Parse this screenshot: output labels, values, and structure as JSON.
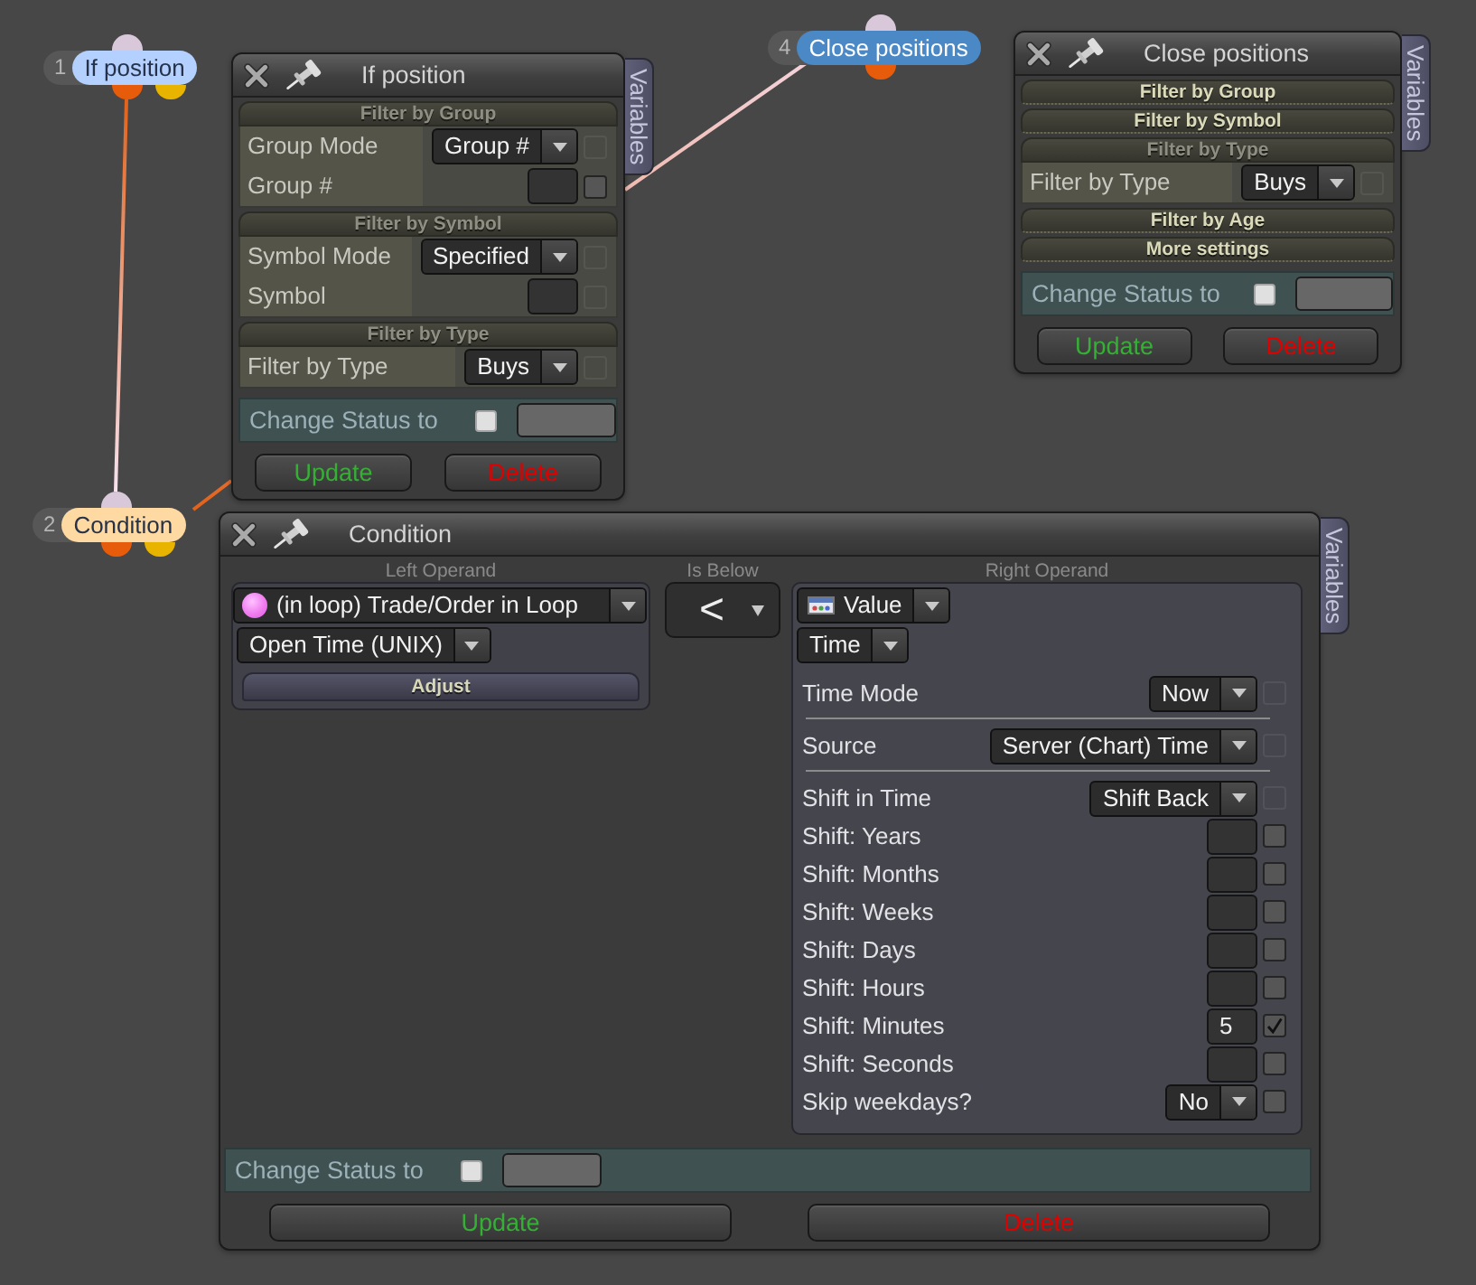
{
  "nodes": [
    {
      "number": "1",
      "label": "If position",
      "color": "#b3d0ff",
      "outputs": [
        {
          "color": "#e65c0a"
        },
        {
          "color": "#e8b400"
        }
      ]
    },
    {
      "number": "2",
      "label": "Condition",
      "color": "#ffd9a2",
      "outputs": [
        {
          "color": "#e65c0a"
        },
        {
          "color": "#e8b400"
        }
      ]
    },
    {
      "number": "4",
      "label": "Close positions",
      "color": "#4a89c6",
      "outputs": [
        {
          "color": "#e65c0a"
        }
      ]
    }
  ],
  "panels": [
    {
      "kind": "filters",
      "title": "If position",
      "side_tab": "Variables",
      "sections": [
        {
          "title": "Filter by Group",
          "expanded": true,
          "rows": [
            {
              "label": "Group Mode",
              "kind": "dropdown",
              "value": "Group #",
              "check": {
                "checked": false,
                "disabled": true
              }
            },
            {
              "label": "Group #",
              "kind": "input",
              "check": {
                "checked": false,
                "disabled": false
              }
            }
          ]
        },
        {
          "title": "Filter by Symbol",
          "expanded": true,
          "rows": [
            {
              "label": "Symbol Mode",
              "kind": "dropdown",
              "value": "Specified",
              "check": {
                "checked": false,
                "disabled": true
              }
            },
            {
              "label": "Symbol",
              "kind": "input",
              "check": {
                "checked": false,
                "disabled": true
              }
            }
          ]
        },
        {
          "title": "Filter by Type",
          "expanded": true,
          "rows": [
            {
              "label": "Filter by Type",
              "kind": "dropdown",
              "value": "Buys",
              "check": {
                "checked": false,
                "disabled": true
              }
            }
          ]
        }
      ],
      "status": {
        "label": "Change Status to",
        "checked": false
      },
      "buttons": [
        {
          "kind": "update",
          "label": "Update"
        },
        {
          "kind": "delete",
          "label": "Delete"
        }
      ]
    },
    {
      "kind": "filters",
      "title": "Close positions",
      "side_tab": "Variables",
      "sections": [
        {
          "title": "Filter by Group",
          "expanded": false
        },
        {
          "title": "Filter by Symbol",
          "expanded": false
        },
        {
          "title": "Filter by Type",
          "expanded": true,
          "rows": [
            {
              "label": "Filter by Type",
              "kind": "dropdown",
              "value": "Buys",
              "check": {
                "checked": false,
                "disabled": true
              }
            }
          ]
        },
        {
          "title": "Filter by Age",
          "expanded": false
        },
        {
          "title": "More settings",
          "expanded": false
        }
      ],
      "status": {
        "label": "Change Status to",
        "checked": false
      },
      "buttons": [
        {
          "kind": "update",
          "label": "Update"
        },
        {
          "kind": "delete",
          "label": "Delete"
        }
      ]
    },
    {
      "kind": "condition",
      "title": "Condition",
      "side_tab": "Variables",
      "left_operand": {
        "heading": "Left Operand",
        "source": "(in loop) Trade/Order in Loop",
        "field": "Open Time (UNIX)",
        "action": "Adjust"
      },
      "operator": {
        "heading": "Is Below",
        "value": "<"
      },
      "right_operand": {
        "heading": "Right Operand",
        "source": "Value",
        "type": "Time",
        "rows": [
          {
            "kind": "dropdown",
            "label": "Time Mode",
            "value": "Now",
            "check": {
              "checked": false,
              "disabled": true
            }
          },
          {
            "kind": "divider"
          },
          {
            "kind": "dropdown",
            "label": "Source",
            "value": "Server (Chart) Time",
            "check": {
              "checked": false,
              "disabled": true
            }
          },
          {
            "kind": "divider"
          },
          {
            "kind": "dropdown",
            "label": "Shift in Time",
            "value": "Shift Back",
            "check": {
              "checked": false,
              "disabled": true
            }
          },
          {
            "kind": "input",
            "label": "Shift: Years",
            "check": {
              "checked": false,
              "disabled": false
            }
          },
          {
            "kind": "input",
            "label": "Shift: Months",
            "check": {
              "checked": false,
              "disabled": false
            }
          },
          {
            "kind": "input",
            "label": "Shift: Weeks",
            "check": {
              "checked": false,
              "disabled": false
            }
          },
          {
            "kind": "input",
            "label": "Shift: Days",
            "check": {
              "checked": false,
              "disabled": false
            }
          },
          {
            "kind": "input",
            "label": "Shift: Hours",
            "check": {
              "checked": false,
              "disabled": false
            }
          },
          {
            "kind": "input",
            "label": "Shift: Minutes",
            "value": "5",
            "check": {
              "checked": true,
              "disabled": false
            }
          },
          {
            "kind": "input",
            "label": "Shift: Seconds",
            "check": {
              "checked": false,
              "disabled": false
            }
          },
          {
            "kind": "dropdown",
            "label": "Skip weekdays?",
            "value": "No",
            "check": {
              "checked": false,
              "disabled": false
            }
          }
        ]
      },
      "status": {
        "label": "Change Status to",
        "checked": false
      },
      "buttons": [
        {
          "kind": "update",
          "label": "Update"
        },
        {
          "kind": "delete",
          "label": "Delete"
        }
      ]
    }
  ]
}
